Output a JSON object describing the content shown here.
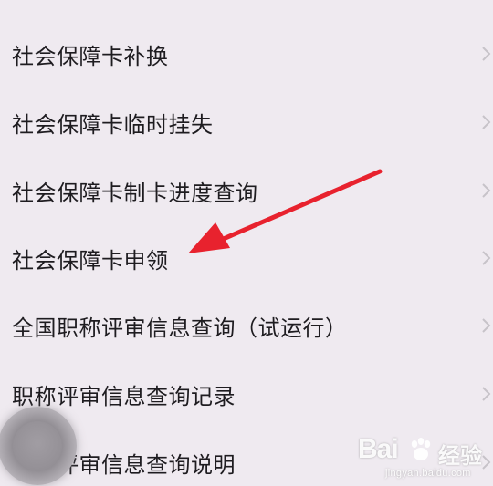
{
  "menu": {
    "items": [
      {
        "label": "社会保障卡补换"
      },
      {
        "label": "社会保障卡临时挂失"
      },
      {
        "label": "社会保障卡制卡进度查询"
      },
      {
        "label": "社会保障卡申领"
      },
      {
        "label": "全国职称评审信息查询（试运行）"
      },
      {
        "label": "职称评审信息查询记录"
      },
      {
        "label": "职称评审信息查询说明"
      }
    ],
    "chevron_icon": "chevron-right-icon"
  },
  "annotation": {
    "icon": "red-arrow-icon",
    "color": "#e8222e"
  },
  "floating_button": {
    "icon": "assistive-touch-icon"
  },
  "watermark": {
    "logo_text": "Bai",
    "paw_icon": "baidu-paw-icon",
    "brand_text": "经验",
    "url": "jingyan.baidu.com"
  },
  "colors": {
    "background": "#efeaf0",
    "text": "#1e1c20",
    "chevron": "#c7c3c9"
  }
}
